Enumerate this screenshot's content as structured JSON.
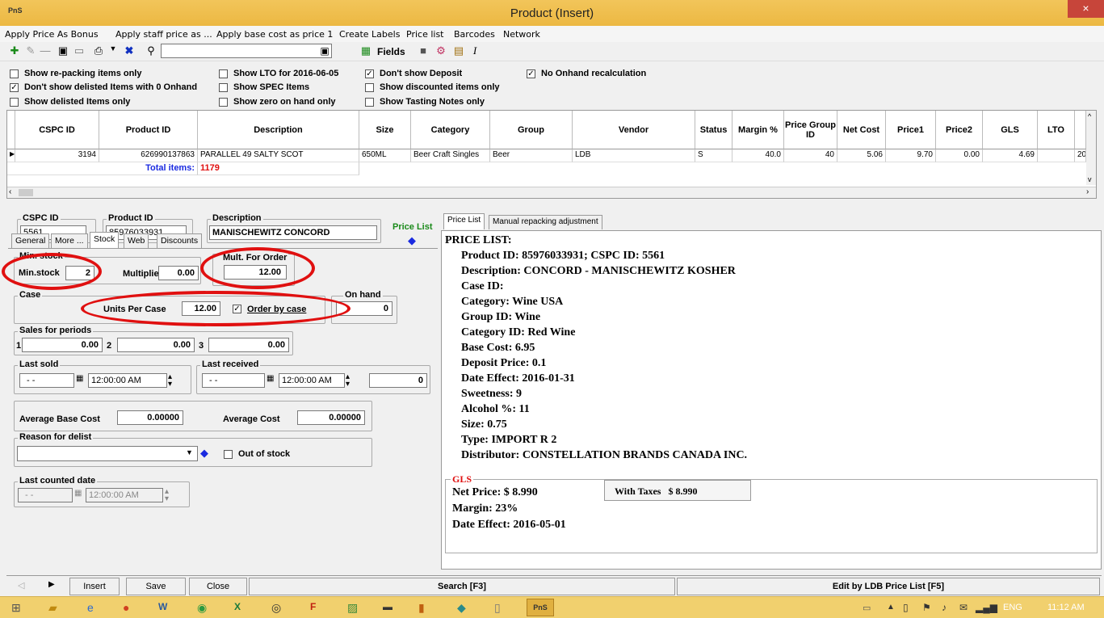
{
  "window": {
    "title": "Product (Insert)",
    "logo": "PnS",
    "close": "×"
  },
  "menu": [
    "Apply Price As Bonus",
    "Apply staff price as ...",
    "Apply base cost as price 1",
    "Create Labels",
    "Price list",
    "Barcodes",
    "Network"
  ],
  "toolbar": {
    "fields_label": "Fields",
    "search_value": ""
  },
  "filters": [
    {
      "label": "Show re-packing items only",
      "checked": false
    },
    {
      "label": "Don't show delisted Items with 0 Onhand",
      "checked": true
    },
    {
      "label": "Show delisted Items only",
      "checked": false
    },
    {
      "label": "Show LTO for 2016-06-05",
      "checked": false
    },
    {
      "label": "Show SPEC Items",
      "checked": false
    },
    {
      "label": "Show zero on hand only",
      "checked": false
    },
    {
      "label": "Don't show Deposit",
      "checked": true
    },
    {
      "label": "Show discounted items only",
      "checked": false
    },
    {
      "label": "Show Tasting Notes only",
      "checked": false
    },
    {
      "label": "No Onhand recalculation",
      "checked": true
    }
  ],
  "grid": {
    "headers": [
      "CSPC ID",
      "Product ID",
      "Description",
      "Size",
      "Category",
      "Group",
      "Vendor",
      "Status",
      "Margin %",
      "Price Group ID",
      "Net Cost",
      "Price1",
      "Price2",
      "GLS",
      "LTO",
      ""
    ],
    "row": [
      "3194",
      "626990137863",
      "PARALLEL 49 SALTY SCOT",
      "650ML",
      "Beer Craft Singles",
      "Beer",
      "LDB",
      "S",
      "40.0",
      "40",
      "5.06",
      "9.70",
      "0.00",
      "4.69",
      "",
      "20"
    ],
    "total_label": "Total items:",
    "total_value": "1179"
  },
  "form": {
    "cspc_label": "CSPC ID",
    "cspc_value": "5561",
    "product_label": "Product ID",
    "product_value": "85976033931",
    "desc_label": "Description",
    "desc_value": "MANISCHEWITZ CONCORD",
    "pricelist_link": "Price List",
    "tabs": [
      "General",
      "More ...",
      "Stock",
      "Web",
      "Discounts"
    ],
    "min_stock_group": "Min. stock",
    "min_stock_label": "Min.stock",
    "min_stock_value": "2",
    "multiplier_label": "Multiplier",
    "multiplier_value": "0.00",
    "mult_order_label": "Mult. For Order",
    "mult_order_value": "12.00",
    "case_label": "Case",
    "units_case_label": "Units Per Case",
    "units_case_value": "12.00",
    "order_by_case_label": "Order by case",
    "order_by_case_checked": true,
    "onhand_label": "On hand",
    "onhand_value": "0",
    "sales_label": "Sales for periods",
    "sales": [
      {
        "n": "1",
        "v": "0.00"
      },
      {
        "n": "2",
        "v": "0.00"
      },
      {
        "n": "3",
        "v": "0.00"
      }
    ],
    "last_sold_label": "Last sold",
    "last_sold_date": "- -",
    "last_sold_time": "12:00:00 AM",
    "last_received_label": "Last received",
    "last_received_date": "- -",
    "last_received_time": "12:00:00 AM",
    "last_received_qty": "0",
    "avg_base_label": "Average Base Cost",
    "avg_base_value": "0.00000",
    "avg_cost_label": "Average Cost",
    "avg_cost_value": "0.00000",
    "delist_label": "Reason for delist",
    "out_of_stock_label": "Out of stock",
    "last_counted_label": "Last counted date",
    "last_counted_date": "- -",
    "last_counted_time": "12:00:00 AM"
  },
  "right": {
    "tabs": [
      "Price List",
      "Manual repacking adjustment"
    ],
    "heading": "PRICE LIST:",
    "lines": [
      "Product ID: 85976033931;   CSPC ID: 5561",
      "Description: CONCORD - MANISCHEWITZ KOSHER",
      "Case ID:",
      "Category: Wine USA",
      "Group ID: Wine",
      "Category ID: Red Wine",
      "Base Cost: 6.95",
      "Deposit Price: 0.1",
      "Date Effect: 2016-01-31",
      "Sweetness: 9",
      "Alcohol %: 11",
      "Size: 0.75",
      "Type: IMPORT R 2",
      "Distributor: CONSTELLATION BRANDS CANADA INC."
    ],
    "gls_label": "GLS",
    "net_price": "Net Price: $ 8.990",
    "with_taxes": "With Taxes   $ 8.990",
    "margin": "Margin: 23%",
    "date_effect": "Date Effect: 2016-05-01"
  },
  "status": {
    "insert": "Insert",
    "save": "Save",
    "close": "Close",
    "search": "Search [F3]",
    "edit": "Edit by LDB Price List [F5]"
  },
  "taskbar": {
    "lang": "ENG",
    "time": "11:12 AM"
  }
}
